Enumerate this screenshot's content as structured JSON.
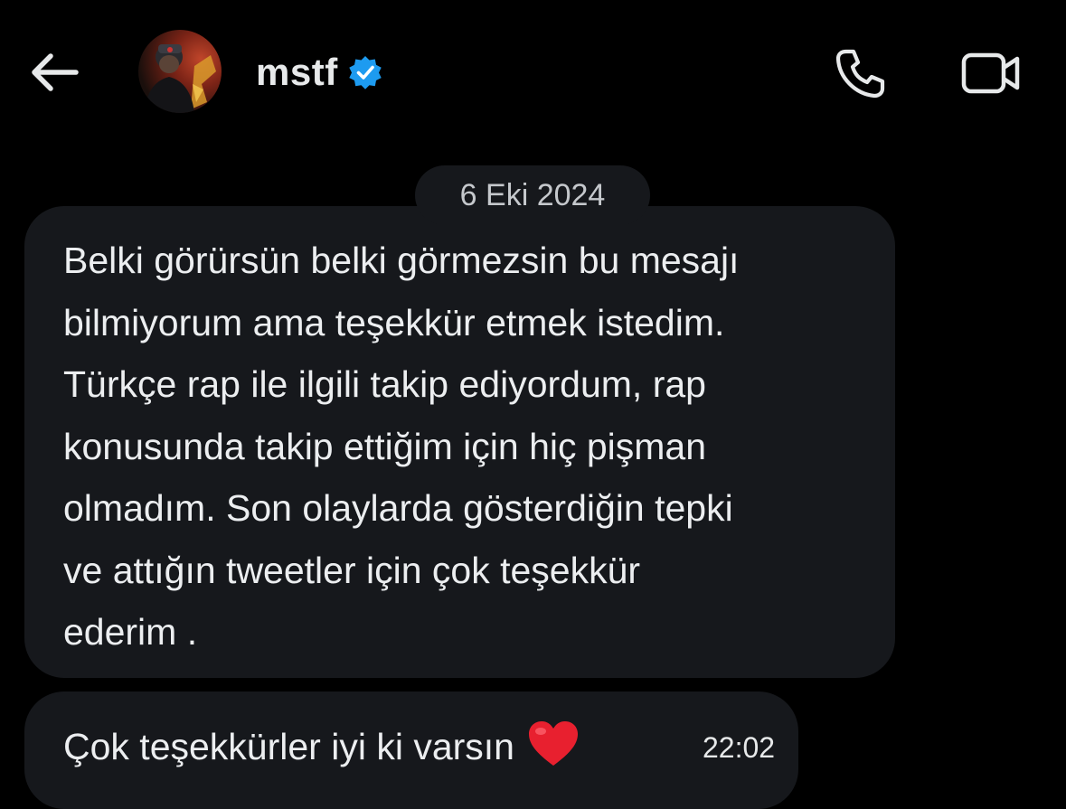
{
  "header": {
    "back_icon": "arrow-left-icon",
    "name": "mstf",
    "verified_icon": "verified-badge-icon",
    "verified_color": "#1d9bf0",
    "call_icon": "phone-icon",
    "video_icon": "video-camera-icon"
  },
  "conversation": {
    "date_separator": "6 Eki 2024",
    "messages": [
      {
        "text": "Belki görürsün belki görmezsin bu mesajı\nbilmiyorum ama teşekkür etmek istedim.\nTürkçe rap ile ilgili takip ediyordum, rap\nkonusunda takip ettiğim için hiç pişman\nolmadım. Son olaylarda gösterdiğin tepki\nve attığın tweetler için çok teşekkür\nederim ."
      },
      {
        "text": "Çok teşekkürler iyi ki varsın",
        "emoji": "❤️",
        "emoji_icon": "red-heart-icon",
        "time": "22:02"
      }
    ]
  },
  "colors": {
    "background": "#000000",
    "bubble": "#16181c",
    "text": "#e7e9ea",
    "heart": "#e8202f"
  }
}
